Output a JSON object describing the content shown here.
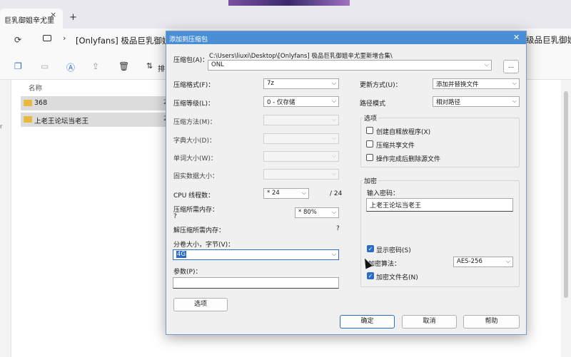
{
  "tab": {
    "title": "巨乳御姐辛尤里",
    "close": "×",
    "add": "+"
  },
  "address": {
    "chevron": "›",
    "path": "[Onlyfans] 极品巨乳御姐辛尤里新增合集",
    "right_text": "级品巨乳御姐",
    "refresh_icon": "refresh-icon",
    "pc_icon": "pc-icon"
  },
  "toolbar": {
    "sort_label": "排"
  },
  "list": {
    "column_name": "名称",
    "sidebar_letter": "r",
    "files": [
      {
        "name": "368",
        "extra": "2"
      },
      {
        "name": "上老王论坛当老王",
        "extra": "2"
      }
    ]
  },
  "dialog": {
    "title": "添加到压缩包",
    "archive": {
      "label": "压缩包(A)：",
      "dir": "C:\\Users\\liuxi\\Desktop\\[Onlyfans] 极品巨乳御姐辛尤里新增合集\\",
      "name": "ONL",
      "browse": "..."
    },
    "left": {
      "format_label": "压缩格式(F)：",
      "format_value": "7z",
      "level_label": "压缩等级(L)：",
      "level_value": "0 - 仅存储",
      "method_label": "压缩方法(M)：",
      "dict_label": "字典大小(D)：",
      "word_label": "单词大小(W)：",
      "solid_label": "固实数据大小：",
      "cpu_label": "CPU 线程数：",
      "cpu_value": "* 24",
      "cpu_total": "/ 24",
      "mem_comp_label": "压缩所需内存：",
      "mem_comp_q": "?",
      "mem_comp_value": "* 80%",
      "mem_decomp_label": "解压缩所需内存：",
      "mem_decomp_value": "?",
      "split_label": "分卷大小，字节(V)：",
      "split_value": "4G",
      "params_label": "参数(P)：",
      "options_button": "选项"
    },
    "right": {
      "update_label": "更新方式(U)：",
      "update_value": "添加并替换文件",
      "path_label": "路径模式",
      "path_value": "相对路径",
      "options_title": "选项",
      "opt_sfx": "创建自释放程序(X)",
      "opt_shared": "压缩共享文件",
      "opt_delete": "操作完成后删除源文件",
      "enc_title": "加密",
      "pwd_label": "输入密码：",
      "pwd_value": "上老王论坛当老王",
      "show_pwd": "显示密码(S)",
      "enc_method_label": "加密算法：",
      "enc_method_value": "AES-256",
      "enc_names": "加密文件名(N)"
    },
    "buttons": {
      "ok": "确定",
      "cancel": "取消",
      "help": "帮助"
    }
  }
}
